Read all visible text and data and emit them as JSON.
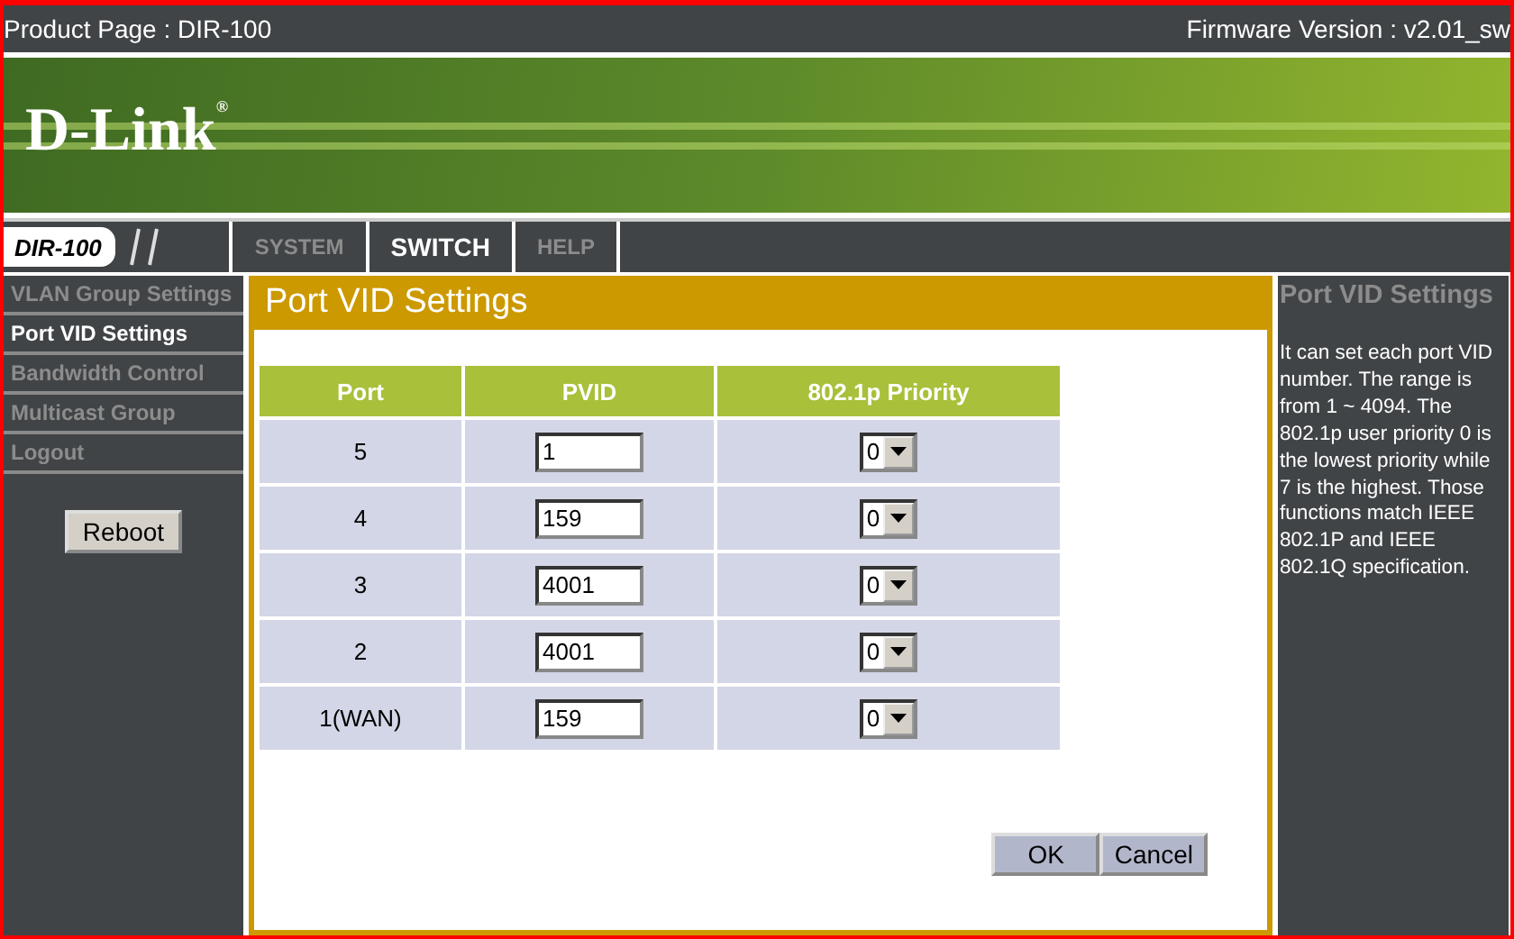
{
  "top_bar": {
    "product": "Product Page : DIR-100",
    "firmware": "Firmware Version : v2.01_sw"
  },
  "banner": {
    "logo": "D-Link",
    "logo_mark": "®"
  },
  "model_tab": "DIR-100",
  "tabs": [
    {
      "label": "SYSTEM",
      "selected": false
    },
    {
      "label": "SWITCH",
      "selected": true
    },
    {
      "label": "HELP",
      "selected": false
    }
  ],
  "sidebar": {
    "items": [
      {
        "label": "VLAN Group Settings",
        "selected": false
      },
      {
        "label": "Port VID Settings",
        "selected": true
      },
      {
        "label": "Bandwidth Control",
        "selected": false
      },
      {
        "label": "Multicast Group",
        "selected": false
      },
      {
        "label": "Logout",
        "selected": false
      }
    ],
    "reboot": "Reboot"
  },
  "panel": {
    "title": "Port VID Settings",
    "columns": [
      "Port",
      "PVID",
      "802.1p Priority"
    ],
    "rows": [
      {
        "port": "5",
        "pvid": "1",
        "priority": "0"
      },
      {
        "port": "4",
        "pvid": "159",
        "priority": "0"
      },
      {
        "port": "3",
        "pvid": "4001",
        "priority": "0"
      },
      {
        "port": "2",
        "pvid": "4001",
        "priority": "0"
      },
      {
        "port": "1(WAN)",
        "pvid": "159",
        "priority": "0"
      }
    ],
    "buttons": [
      "OK",
      "Cancel"
    ]
  },
  "help": {
    "title": "Port VID Settings",
    "text": "It can set each port VID number. The range is from 1 ~ 4094. The 802.1p user priority 0 is the lowest priority while 7 is the highest. Those functions match IEEE 802.1P and IEEE 802.1Q specification."
  }
}
